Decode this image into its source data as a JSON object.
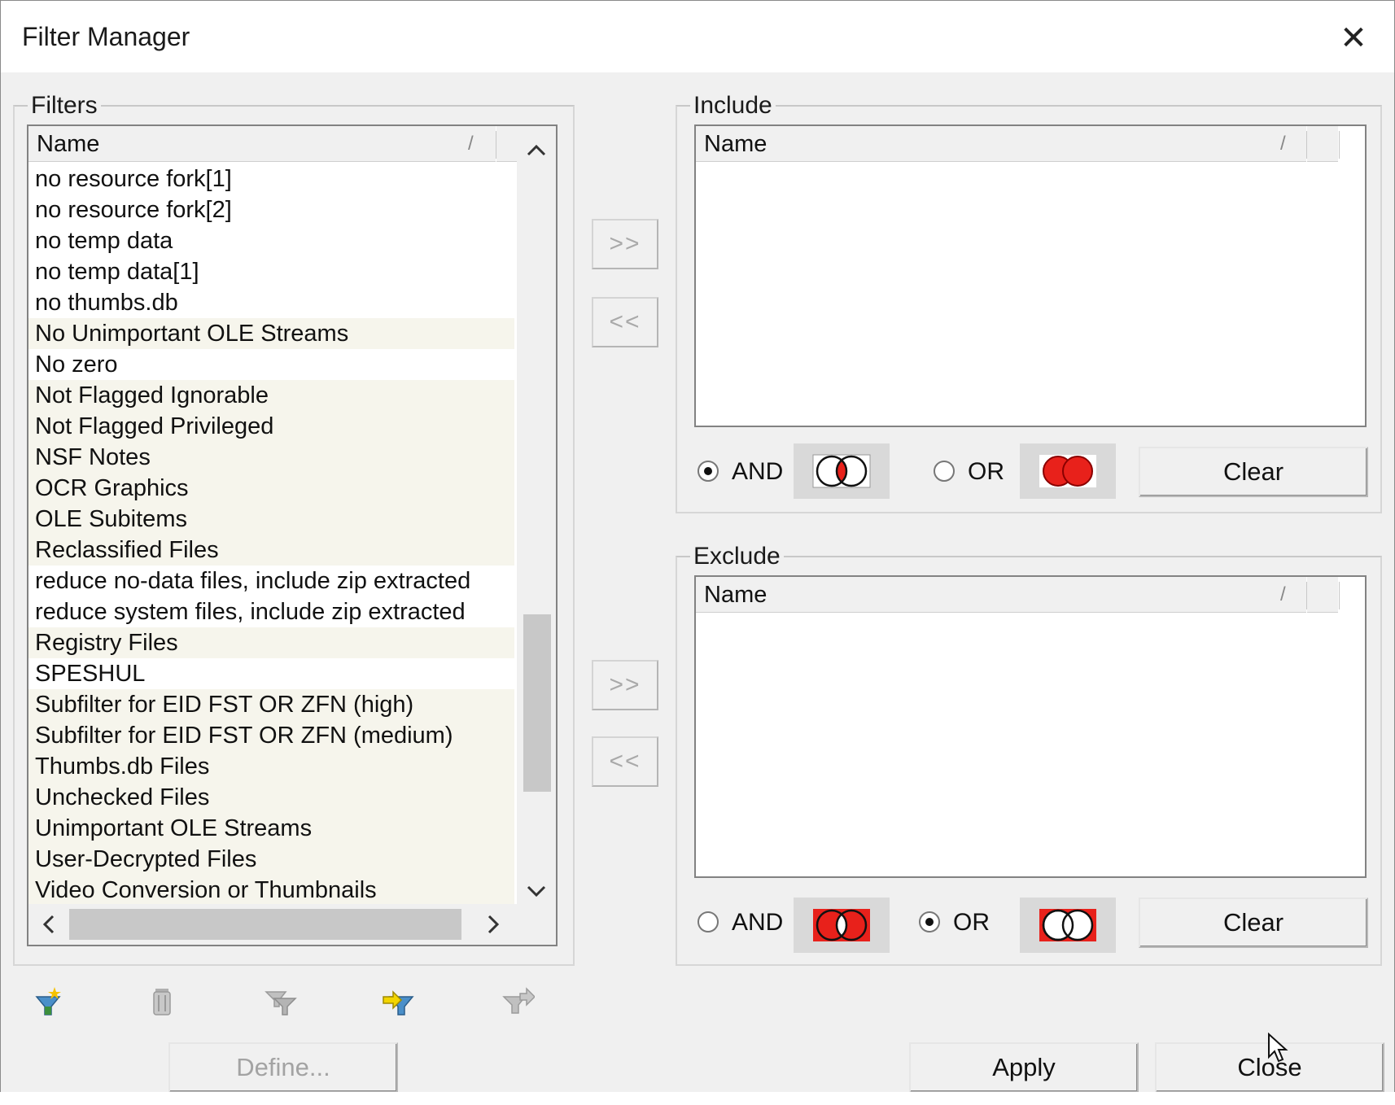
{
  "window": {
    "title": "Filter Manager",
    "close_glyph": "✕"
  },
  "filters": {
    "legend": "Filters",
    "column": {
      "name": "Name",
      "sort_glyph": "/"
    },
    "items": [
      {
        "label": "no resource fork[1]",
        "highlighted": false
      },
      {
        "label": "no resource fork[2]",
        "highlighted": false
      },
      {
        "label": "no temp data",
        "highlighted": false
      },
      {
        "label": "no temp data[1]",
        "highlighted": false
      },
      {
        "label": "no thumbs.db",
        "highlighted": false
      },
      {
        "label": "No Unimportant OLE Streams",
        "highlighted": true
      },
      {
        "label": "No zero",
        "highlighted": false
      },
      {
        "label": "Not Flagged Ignorable",
        "highlighted": true
      },
      {
        "label": "Not Flagged Privileged",
        "highlighted": true
      },
      {
        "label": "NSF Notes",
        "highlighted": true
      },
      {
        "label": "OCR Graphics",
        "highlighted": true
      },
      {
        "label": "OLE Subitems",
        "highlighted": true
      },
      {
        "label": "Reclassified Files",
        "highlighted": true
      },
      {
        "label": "reduce no-data files, include zip extracted",
        "highlighted": false
      },
      {
        "label": "reduce system files, include zip extracted",
        "highlighted": false
      },
      {
        "label": "Registry Files",
        "highlighted": true
      },
      {
        "label": "SPESHUL",
        "highlighted": false
      },
      {
        "label": "Subfilter for EID FST OR ZFN (high)",
        "highlighted": true
      },
      {
        "label": "Subfilter for EID FST OR ZFN (medium)",
        "highlighted": true
      },
      {
        "label": "Thumbs.db Files",
        "highlighted": true
      },
      {
        "label": "Unchecked Files",
        "highlighted": true
      },
      {
        "label": "Unimportant OLE Streams",
        "highlighted": true
      },
      {
        "label": "User-Decrypted Files",
        "highlighted": true
      },
      {
        "label": "Video Conversion or Thumbnails",
        "highlighted": true
      }
    ]
  },
  "move_buttons": {
    "add": ">>",
    "remove": "<<"
  },
  "include": {
    "legend": "Include",
    "column": {
      "name": "Name",
      "sort_glyph": "/"
    },
    "and_label": "AND",
    "or_label": "OR",
    "selected": "AND",
    "clear_label": "Clear"
  },
  "exclude": {
    "legend": "Exclude",
    "column": {
      "name": "Name",
      "sort_glyph": "/"
    },
    "and_label": "AND",
    "or_label": "OR",
    "selected": "OR",
    "clear_label": "Clear"
  },
  "toolbar": {
    "icons": [
      "new-filter-icon",
      "delete-filter-icon",
      "copy-filter-icon",
      "import-filter-icon",
      "export-filter-icon"
    ]
  },
  "footer": {
    "define_label": "Define...",
    "apply_label": "Apply",
    "close_label": "Close"
  },
  "colors": {
    "venn_red": "#e8211b",
    "highlight_row": "#f6f5ec"
  }
}
